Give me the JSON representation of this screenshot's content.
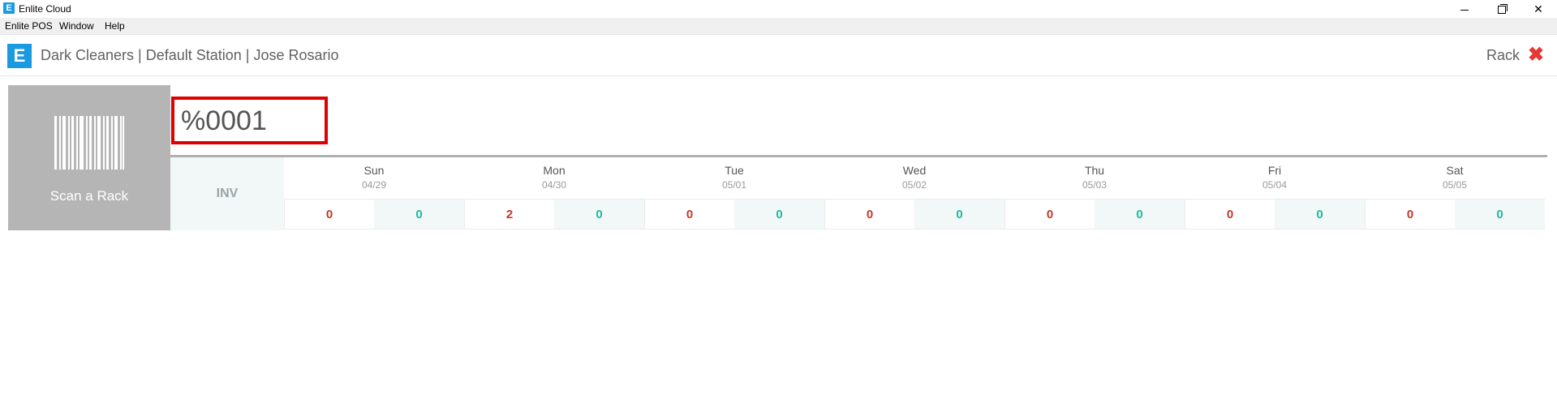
{
  "window": {
    "title": "Enlite Cloud",
    "icon": "E"
  },
  "menubar": {
    "items": [
      "Enlite POS",
      "Window",
      "Help"
    ]
  },
  "header": {
    "logo": "E",
    "title": "Dark Cleaners | Default Station | Jose Rosario",
    "rack_label": "Rack",
    "close_glyph": "✖"
  },
  "scan": {
    "label": "Scan a Rack",
    "input_value": "%0001"
  },
  "grid": {
    "inv_label": "INV",
    "days": [
      {
        "name": "Sun",
        "date": "04/29",
        "red": "0",
        "teal": "0"
      },
      {
        "name": "Mon",
        "date": "04/30",
        "red": "2",
        "teal": "0"
      },
      {
        "name": "Tue",
        "date": "05/01",
        "red": "0",
        "teal": "0"
      },
      {
        "name": "Wed",
        "date": "05/02",
        "red": "0",
        "teal": "0"
      },
      {
        "name": "Thu",
        "date": "05/03",
        "red": "0",
        "teal": "0"
      },
      {
        "name": "Fri",
        "date": "05/04",
        "red": "0",
        "teal": "0"
      },
      {
        "name": "Sat",
        "date": "05/05",
        "red": "0",
        "teal": "0"
      }
    ]
  },
  "colors": {
    "accent": "#1a9ae0",
    "highlight_border": "#e00000",
    "count_red": "#c0392b",
    "count_teal": "#1abc9c"
  }
}
